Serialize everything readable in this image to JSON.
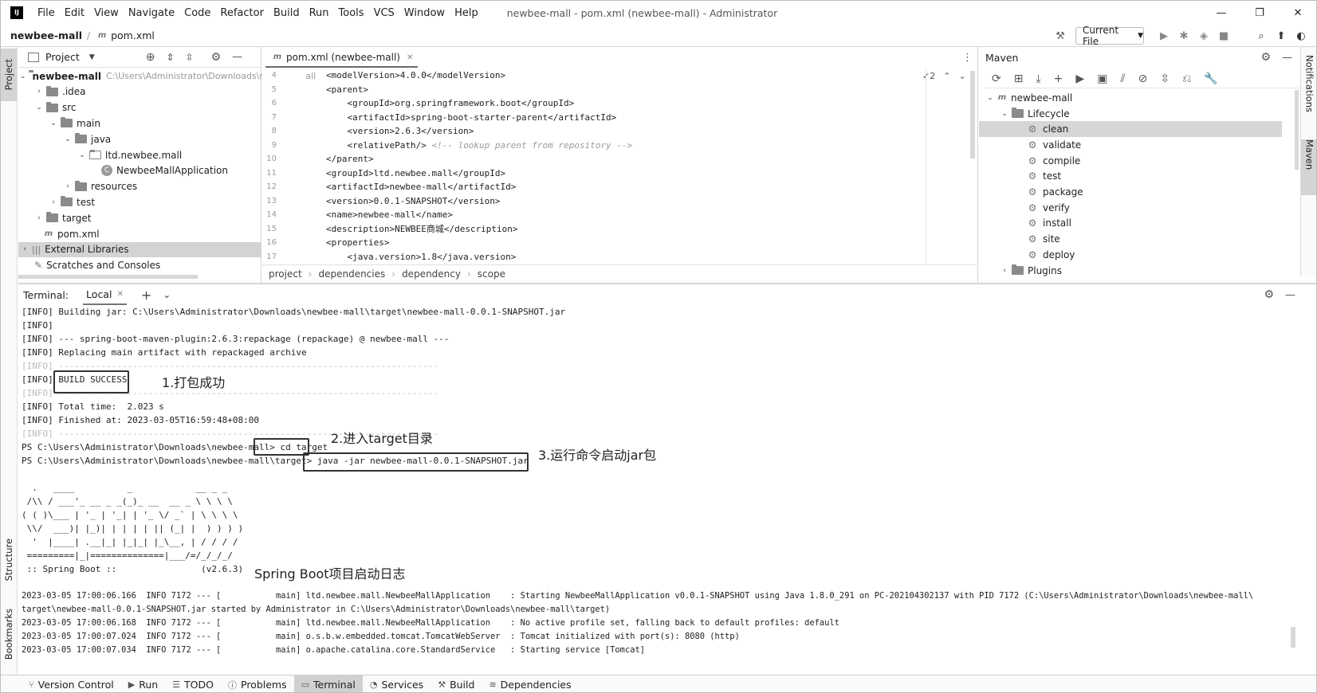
{
  "window": {
    "title": "newbee-mall - pom.xml (newbee-mall) - Administrator",
    "menu": [
      "File",
      "Edit",
      "View",
      "Navigate",
      "Code",
      "Refactor",
      "Build",
      "Run",
      "Tools",
      "VCS",
      "Window",
      "Help"
    ],
    "logo": "IJ"
  },
  "breadcrumb": {
    "project": "newbee-mall",
    "file": "pom.xml",
    "separator": "/"
  },
  "run_config": "Current File",
  "left_strip": {
    "top": "Project",
    "structure": "Structure",
    "bookmarks": "Bookmarks"
  },
  "right_strip": {
    "notifications": "Notifications",
    "maven": "Maven"
  },
  "project_pane": {
    "title": "Project",
    "tree": [
      {
        "label": "newbee-mall",
        "path": "C:\\Users\\Administrator\\Downloads\\newbee-mall",
        "bold": true
      },
      {
        "label": ".idea"
      },
      {
        "label": "src"
      },
      {
        "label": "main"
      },
      {
        "label": "java"
      },
      {
        "label": "ltd.newbee.mall"
      },
      {
        "label": "NewbeeMallApplication"
      },
      {
        "label": "resources"
      },
      {
        "label": "test"
      },
      {
        "label": "target"
      },
      {
        "label": "pom.xml"
      },
      {
        "label": "External Libraries"
      },
      {
        "label": "Scratches and Consoles"
      }
    ]
  },
  "editor": {
    "tab": "pom.xml (newbee-mall)",
    "warnings": "2",
    "line_numbers": [
      "4",
      "5",
      "6",
      "7",
      "8",
      "9",
      "10",
      "11",
      "12",
      "13",
      "14",
      "15",
      "16",
      "17"
    ],
    "lines": [
      "<modelVersion>4.0.0</modelVersion>",
      "<parent>",
      "    <groupId>org.springframework.boot</groupId>",
      "    <artifactId>spring-boot-starter-parent</artifactId>",
      "    <version>2.6.3</version>",
      "    <relativePath/> ",
      "</parent>",
      "<groupId>ltd.newbee.mall</groupId>",
      "<artifactId>newbee-mall</artifactId>",
      "<version>0.0.1-SNAPSHOT</version>",
      "<name>newbee-mall</name>",
      "<description>NEWBEE商城</description>",
      "<properties>",
      "    <java.version>1.8</java.version>"
    ],
    "comment": "<!-- lookup parent from repository -->",
    "crumbs": [
      "project",
      "dependencies",
      "dependency",
      "scope"
    ]
  },
  "maven": {
    "title": "Maven",
    "root": "newbee-mall",
    "lifecycle": "Lifecycle",
    "goals": [
      "clean",
      "validate",
      "compile",
      "test",
      "package",
      "verify",
      "install",
      "site",
      "deploy"
    ],
    "plugins": "Plugins"
  },
  "terminal": {
    "title": "Terminal:",
    "tab": "Local",
    "lines": [
      "[INFO] Building jar: C:\\Users\\Administrator\\Downloads\\newbee-mall\\target\\newbee-mall-0.0.1-SNAPSHOT.jar",
      "[INFO]",
      "[INFO] --- spring-boot-maven-plugin:2.6.3:repackage (repackage) @ newbee-mall ---",
      "[INFO] Replacing main artifact with repackaged archive",
      "[INFO] ------------------------------------------------------------------------",
      "[INFO] BUILD SUCCESS",
      "[INFO] ------------------------------------------------------------------------",
      "[INFO] Total time:  2.023 s",
      "[INFO] Finished at: 2023-03-05T16:59:48+08:00",
      "[INFO] ------------------------------------------------------------------------",
      "PS C:\\Users\\Administrator\\Downloads\\newbee-mall> cd target",
      "PS C:\\Users\\Administrator\\Downloads\\newbee-mall\\target> java -jar newbee-mall-0.0.1-SNAPSHOT.jar",
      "",
      "  .   ____          _            __ _ _",
      " /\\\\ / ___'_ __ _ _(_)_ __  __ _ \\ \\ \\ \\",
      "( ( )\\___ | '_ | '_| | '_ \\/ _` | \\ \\ \\ \\",
      " \\\\/  ___)| |_)| | | | | || (_| |  ) ) ) )",
      "  '  |____| .__|_| |_|_| |_\\__, | / / / /",
      " =========|_|==============|___/=/_/_/_/",
      " :: Spring Boot ::                (v2.6.3)",
      "",
      "2023-03-05 17:00:06.166  INFO 7172 --- [           main] ltd.newbee.mall.NewbeeMallApplication    : Starting NewbeeMallApplication v0.0.1-SNAPSHOT using Java 1.8.0_291 on PC-202104302137 with PID 7172 (C:\\Users\\Administrator\\Downloads\\newbee-mall\\",
      "target\\newbee-mall-0.0.1-SNAPSHOT.jar started by Administrator in C:\\Users\\Administrator\\Downloads\\newbee-mall\\target)",
      "2023-03-05 17:00:06.168  INFO 7172 --- [           main] ltd.newbee.mall.NewbeeMallApplication    : No active profile set, falling back to default profiles: default",
      "2023-03-05 17:00:07.024  INFO 7172 --- [           main] o.s.b.w.embedded.tomcat.TomcatWebServer  : Tomcat initialized with port(s): 8080 (http)",
      "2023-03-05 17:00:07.034  INFO 7172 --- [           main] o.apache.catalina.core.StandardService   : Starting service [Tomcat]"
    ],
    "annotations": {
      "a1": "1.打包成功",
      "a2": "2.进入target目录",
      "a3": "3.运行命令启动jar包",
      "a4": "Spring Boot项目启动日志"
    }
  },
  "statusbar": [
    "Version Control",
    "Run",
    "TODO",
    "Problems",
    "Terminal",
    "Services",
    "Build",
    "Dependencies"
  ]
}
